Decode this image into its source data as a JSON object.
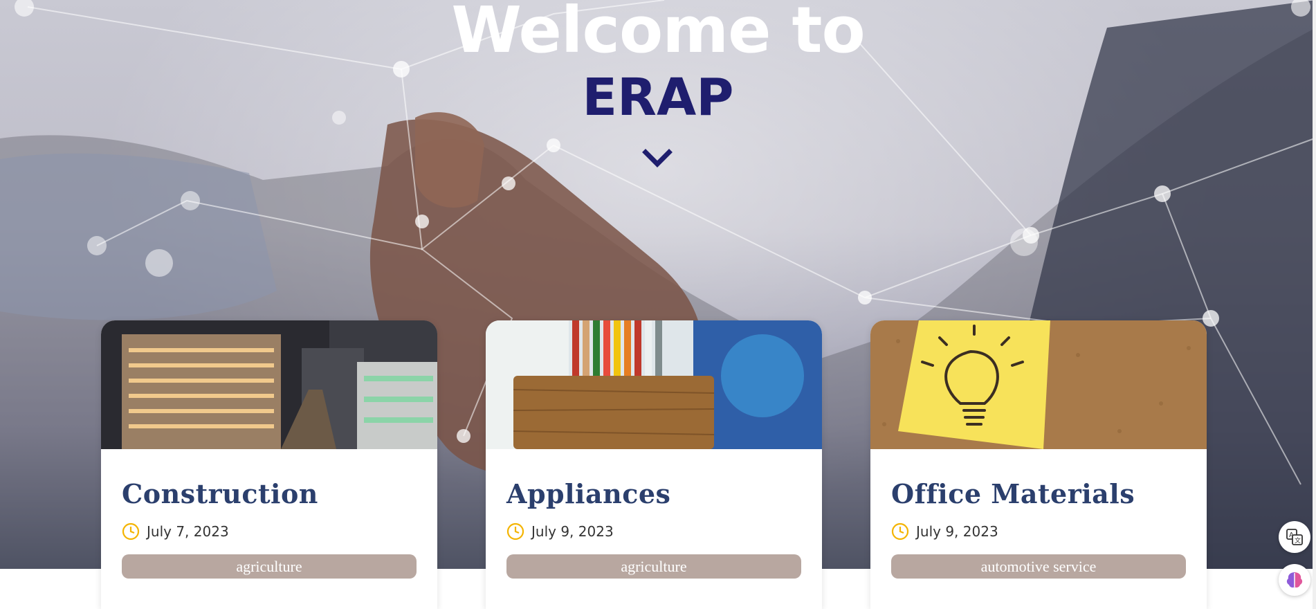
{
  "hero": {
    "title_line1": "Welcome to",
    "title_line2": "ERAP",
    "accent_color": "#1f1e6e"
  },
  "cards": [
    {
      "title": "Construction",
      "date": "July 7, 2023",
      "tag": "agriculture",
      "image": "building-photo"
    },
    {
      "title": "Appliances",
      "date": "July 9, 2023",
      "tag": "agriculture",
      "image": "pencil-holder-photo"
    },
    {
      "title": "Office Materials",
      "date": "July 9, 2023",
      "tag": "automotive service",
      "image": "lightbulb-note-photo"
    }
  ],
  "icons": {
    "scroll": "chevron-down-icon",
    "date": "clock-icon",
    "translate": "translate-icon",
    "assistant": "brain-icon"
  },
  "colors": {
    "card_title": "#2b3f6d",
    "clock": "#f4b400",
    "tag_bg": "#b8a7a0"
  }
}
